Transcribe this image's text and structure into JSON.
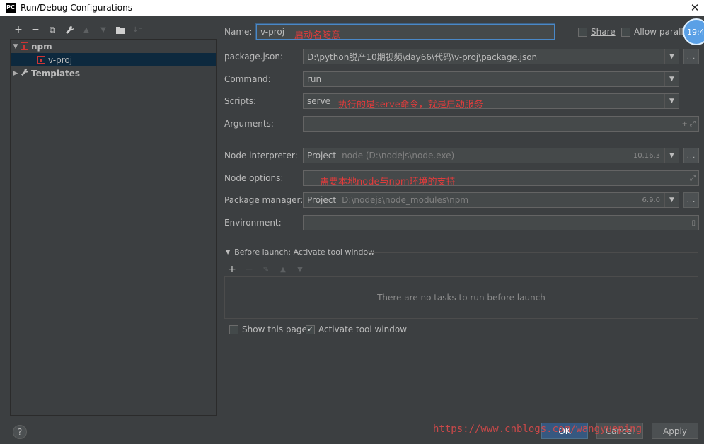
{
  "window": {
    "title": "Run/Debug Configurations",
    "app_icon": "PC",
    "close": "✕"
  },
  "toolbar": {
    "add": "+",
    "remove": "−",
    "copy": "⧉",
    "edit": "🔧",
    "up": "▲",
    "down": "▼",
    "folder": "📁",
    "sort": "↓⁼"
  },
  "tree": {
    "root": {
      "label": "npm",
      "arrow": "▼"
    },
    "child": {
      "label": "v-proj"
    },
    "templates": {
      "label": "Templates",
      "arrow": "▶"
    }
  },
  "clock": {
    "text": "19:4"
  },
  "form": {
    "name": {
      "label": "Name:",
      "value": "v-proj",
      "annotation": "启动名随意"
    },
    "share": {
      "label": "Share",
      "checked": false
    },
    "allow_parallel": {
      "label": "Allow paralle",
      "checked": false
    },
    "package_json": {
      "label": "package.json:",
      "value": "D:\\python脱产10期视频\\day66\\代码\\v-proj\\package.json"
    },
    "command": {
      "label": "Command:",
      "value": "run"
    },
    "scripts": {
      "label": "Scripts:",
      "value": "serve",
      "annotation": "执行的是serve命令，就是启动服务"
    },
    "arguments": {
      "label": "Arguments:",
      "value": ""
    },
    "node_interpreter": {
      "label": "Node interpreter:",
      "kind": "Project",
      "path": "node (D:\\nodejs\\node.exe)",
      "version": "10.16.3"
    },
    "node_options": {
      "label": "Node options:",
      "value": "",
      "annotation": "需要本地node与npm环境的支持"
    },
    "package_manager": {
      "label": "Package manager:",
      "kind": "Project",
      "path": "D:\\nodejs\\node_modules\\npm",
      "version": "6.9.0"
    },
    "environment": {
      "label": "Environment:",
      "value": ""
    }
  },
  "before_launch": {
    "title": "Before launch: Activate tool window",
    "empty_text": "There are no tasks to run before launch",
    "show_this_page": {
      "label": "Show this page",
      "checked": false
    },
    "activate_tool_window": {
      "label": "Activate tool window",
      "checked": true
    }
  },
  "buttons": {
    "ok": "OK",
    "cancel": "Cancel",
    "apply": "Apply",
    "help": "?",
    "dots": "..."
  },
  "watermark": "https://www.cnblogs.com/wangyueping",
  "colors": {
    "background": "#3c3f41",
    "selection": "#0d293e",
    "accent": "#365880",
    "annotation": "#e03c3c"
  }
}
